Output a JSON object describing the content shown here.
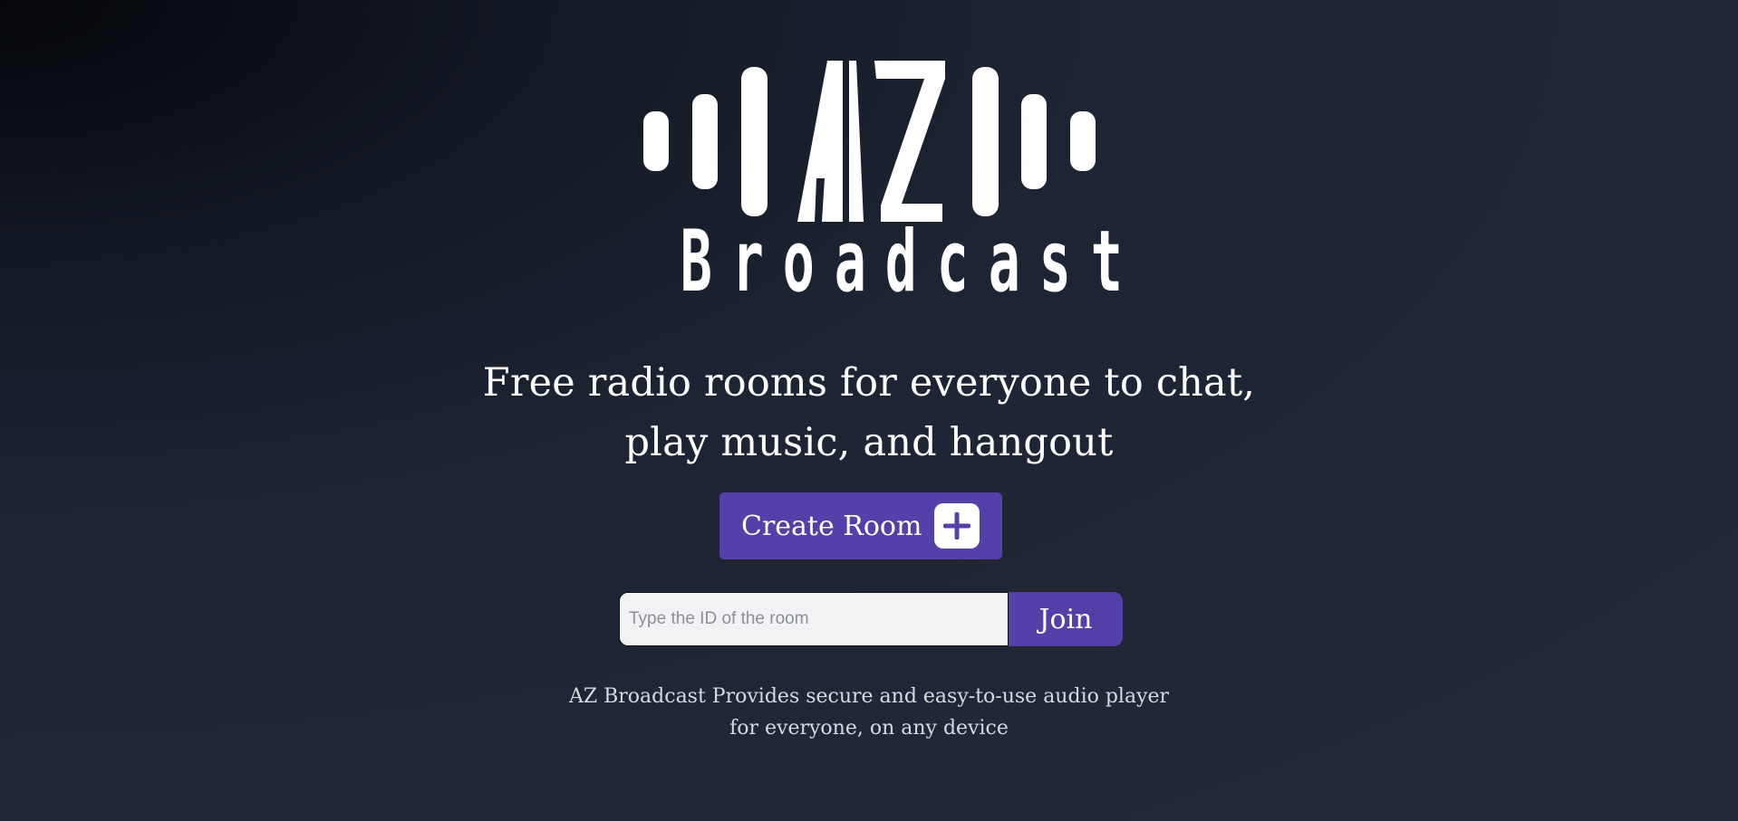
{
  "logo": {
    "mark": "AZ",
    "brand_name": "Broadcast"
  },
  "hero": {
    "tagline_line1": "Free radio rooms for everyone to chat,",
    "tagline_line2": "play music, and hangout"
  },
  "create_room": {
    "label": "Create Room",
    "icon": "plus-icon"
  },
  "join": {
    "placeholder": "Type the ID of the room",
    "value": "",
    "button_label": "Join"
  },
  "footer": {
    "line1": "AZ Broadcast Provides secure and easy-to-use audio player",
    "line2": "for everyone, on any device"
  },
  "colors": {
    "accent": "#553fa8",
    "background": "#1e2535",
    "text": "#ffffff"
  }
}
